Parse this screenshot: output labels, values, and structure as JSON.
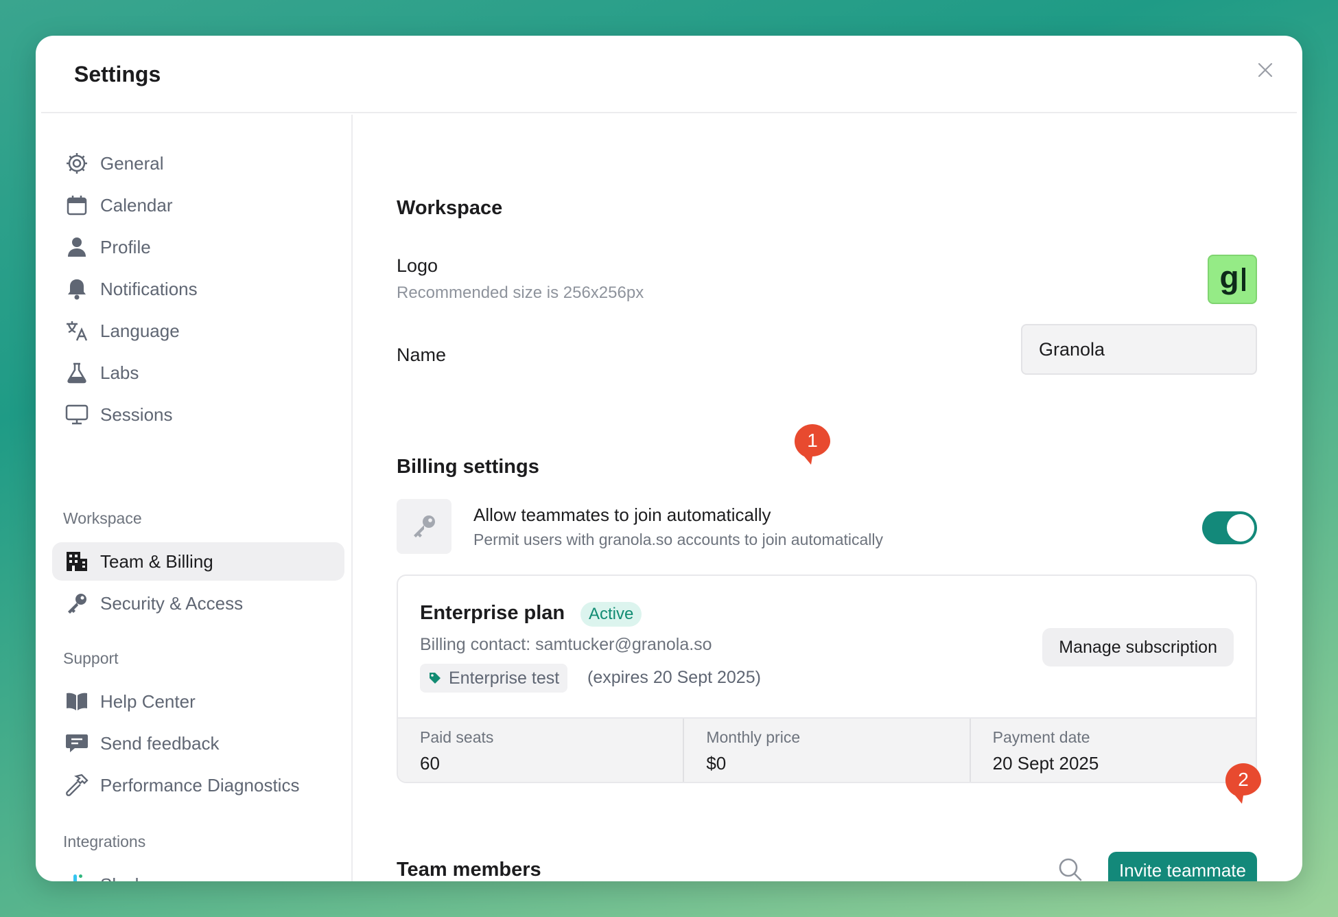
{
  "window": {
    "title": "Settings"
  },
  "sidebar": {
    "items": [
      {
        "label": "General",
        "icon": "gear-icon"
      },
      {
        "label": "Calendar",
        "icon": "calendar-icon"
      },
      {
        "label": "Profile",
        "icon": "person-icon"
      },
      {
        "label": "Notifications",
        "icon": "bell-icon"
      },
      {
        "label": "Language",
        "icon": "translate-icon"
      },
      {
        "label": "Labs",
        "icon": "flask-icon"
      },
      {
        "label": "Sessions",
        "icon": "monitor-icon"
      }
    ],
    "workspace_heading": "Workspace",
    "workspace_items": [
      {
        "label": "Team & Billing",
        "icon": "building-icon",
        "active": true
      },
      {
        "label": "Security & Access",
        "icon": "key-icon"
      }
    ],
    "support_heading": "Support",
    "support_items": [
      {
        "label": "Help Center",
        "icon": "book-icon"
      },
      {
        "label": "Send feedback",
        "icon": "chat-icon"
      },
      {
        "label": "Performance Diagnostics",
        "icon": "hammer-icon"
      }
    ],
    "integrations_heading": "Integrations",
    "integration_items": [
      {
        "label": "Slack",
        "icon": "slack-icon"
      }
    ]
  },
  "workspace": {
    "heading": "Workspace",
    "logo_label": "Logo",
    "logo_hint": "Recommended size is 256x256px",
    "logo_letter": "g",
    "name_label": "Name",
    "name_value": "Granola"
  },
  "billing": {
    "heading": "Billing settings",
    "auto_join_title": "Allow teammates to join automatically",
    "auto_join_desc": "Permit users with granola.so accounts to join automatically",
    "auto_join_enabled": true,
    "plan": {
      "name": "Enterprise plan",
      "status": "Active",
      "contact": "Billing contact: samtucker@granola.so",
      "tag": "Enterprise test",
      "expires": "(expires 20 Sept 2025)",
      "manage_label": "Manage subscription",
      "stats": [
        {
          "label": "Paid seats",
          "value": "60"
        },
        {
          "label": "Monthly price",
          "value": "$0"
        },
        {
          "label": "Payment date",
          "value": "20 Sept 2025"
        }
      ]
    }
  },
  "team": {
    "heading": "Team members",
    "invite_label": "Invite teammate"
  },
  "markers": [
    "1",
    "2"
  ],
  "colors": {
    "accent": "#13897a",
    "marker": "#e84a2f",
    "logo_bg": "#95eb86"
  }
}
